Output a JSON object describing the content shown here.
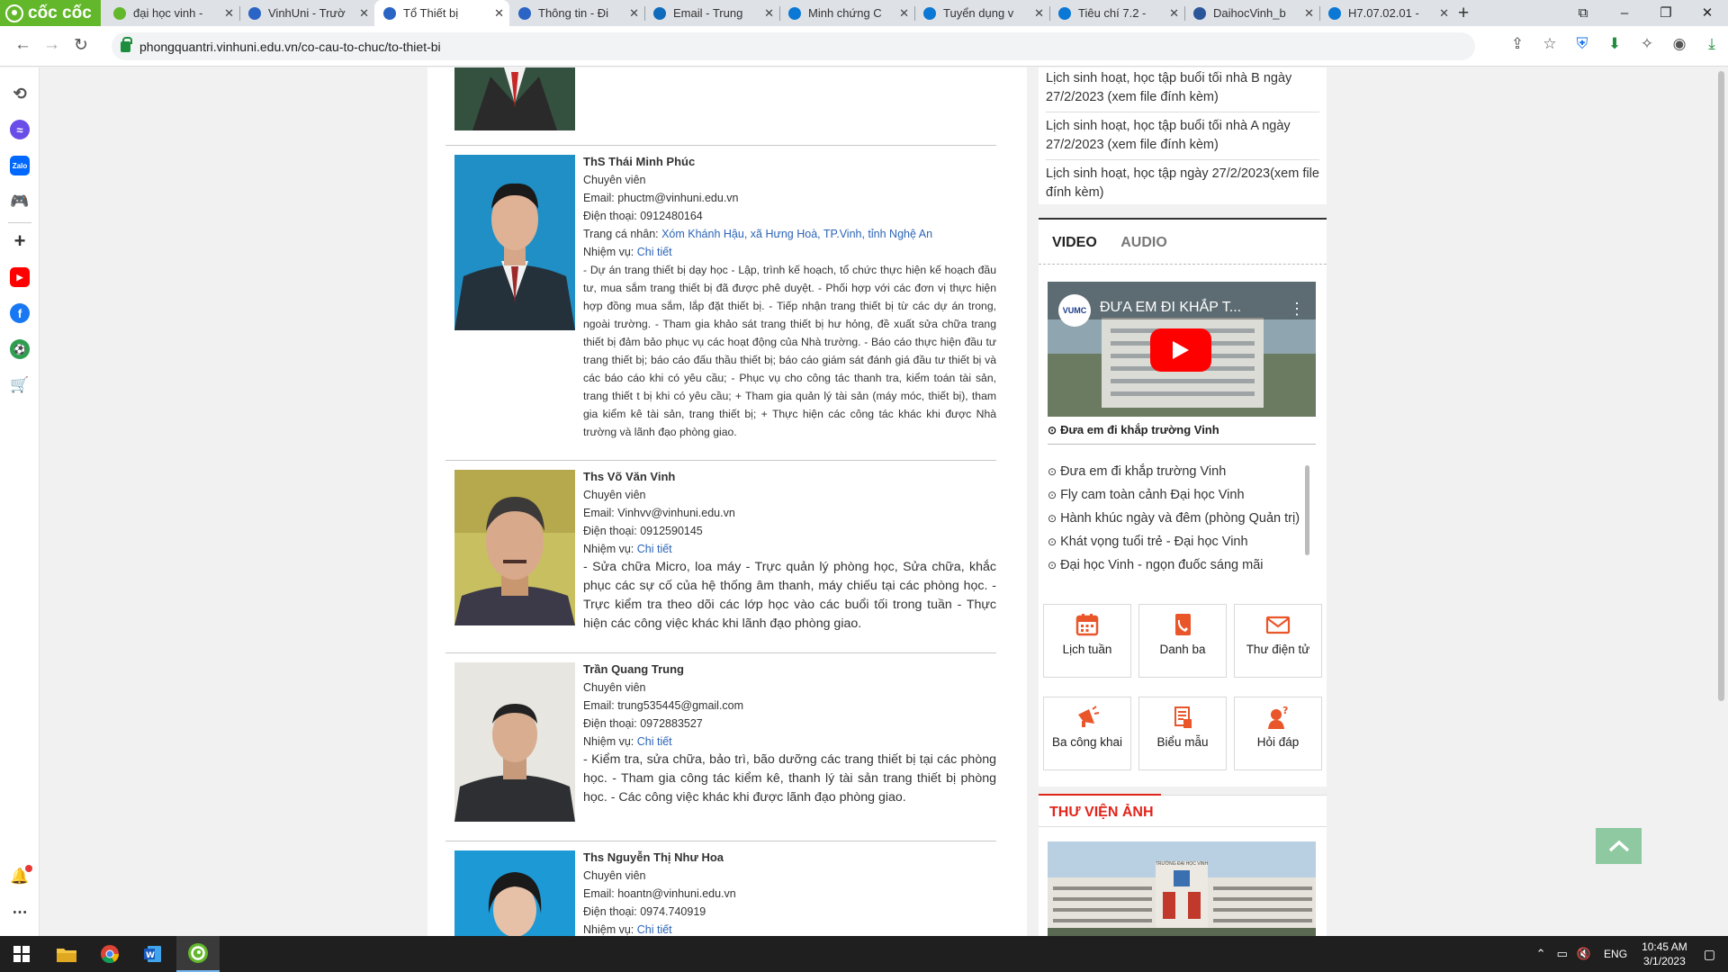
{
  "browser": {
    "brand": "cốc cốc",
    "tabs": [
      {
        "title": "đại học vinh -",
        "color": "#63b72b",
        "active": false
      },
      {
        "title": "VinhUni - Trườ",
        "color": "#2a64c5",
        "active": false
      },
      {
        "title": "Tổ Thiết bị",
        "color": "#2a64c5",
        "active": true
      },
      {
        "title": "Thông tin - Đi",
        "color": "#2a64c5",
        "active": false
      },
      {
        "title": "Email - Trung",
        "color": "#0f6cbd",
        "active": false
      },
      {
        "title": "Minh chứng C",
        "color": "#0a78d4",
        "active": false
      },
      {
        "title": "Tuyển dụng v",
        "color": "#0a78d4",
        "active": false
      },
      {
        "title": "Tiêu chí 7.2 -",
        "color": "#0a78d4",
        "active": false
      },
      {
        "title": "DaihocVinh_b",
        "color": "#2b579a",
        "active": false
      },
      {
        "title": "H7.07.02.01 -",
        "color": "#0a78d4",
        "active": false
      }
    ],
    "url": "phongquantri.vinhuni.edu.vn/co-cau-to-chuc/to-thiet-bi"
  },
  "staff": [
    {
      "name": "ThS Thái Minh Phúc",
      "role": "Chuyên viên",
      "email": "Email: phuctm@vinhuni.edu.vn",
      "phone": "Điện thoại: 0912480164",
      "homepage_label": "Trang cá nhân: ",
      "homepage_value": "Xóm Khánh Hậu, xã Hưng Hoà, TP.Vinh, tỉnh Nghệ An",
      "duty_label": "Nhiệm vụ: ",
      "duty_link": "Chi tiết",
      "duties": "- Dự án trang thiết bị dạy học - Lập, trình kế hoạch, tổ chức thực hiện kế hoạch đầu tư, mua sắm trang thiết bị đã được phê duyệt. - Phối hợp với các đơn vị thực hiện hợp đồng mua sắm, lắp đặt thiết bị. - Tiếp nhận trang thiết bị từ các dự án trong, ngoài trường. - Tham gia khảo sát trang thiết bị hư hỏng, đề xuất sửa chữa trang thiết bị đảm bảo phục vụ các hoạt động của Nhà trường. - Báo cáo thực hiện đầu tư trang thiết bị; báo cáo đấu thầu thiết bị; báo cáo giám sát đánh giá đầu tư thiết bị và các báo cáo khi có yêu cầu; - Phục vụ cho công tác thanh tra, kiểm toán tài sản, trang thiết t bị khi có yêu cầu; + Tham gia quản lý tài sản (máy móc, thiết bị), tham gia kiểm kê tài sản, trang thiết bị; + Thực hiện các công tác khác khi được Nhà trường và lãnh đạo phòng giao."
    },
    {
      "name": "Ths Võ Văn Vinh",
      "role": "Chuyên viên",
      "email": "Email: Vinhvv@vinhuni.edu.vn",
      "phone": "Điện thoại: 0912590145",
      "duty_label": "Nhiệm vụ: ",
      "duty_link": "Chi tiết",
      "duties": "- Sửa chữa Micro, loa máy - Trực quản lý phòng học, Sửa chữa, khắc phục các sự cố của hệ thống âm thanh, máy chiếu tại các phòng học. - Trực kiểm tra theo dõi các lớp học vào các buổi tối trong tuần - Thực hiện các công việc khác khi lãnh đạo phòng giao."
    },
    {
      "name": "Trần Quang Trung",
      "role": "Chuyên viên",
      "email": "Email: trung535445@gmail.com",
      "phone": "Điện thoại: 0972883527",
      "duty_label": "Nhiệm vụ: ",
      "duty_link": "Chi tiết",
      "duties": "- Kiểm tra, sửa chữa, bảo trì, bão dưỡng các trang thiết bị tại các phòng học. - Tham gia công tác kiểm kê, thanh lý tài sản trang thiết bị phòng học. - Các công việc khác khi được lãnh đạo phòng giao."
    },
    {
      "name": "Ths Nguyễn Thị Như Hoa",
      "role": "Chuyên viên",
      "email": "Email: hoantn@vinhuni.edu.vn",
      "phone": "Điện thoại: 0974.740919",
      "duty_label": "Nhiệm vụ: ",
      "duty_link": "Chi tiết"
    }
  ],
  "sidebar": {
    "news": [
      "Lịch sinh hoạt, học tập buổi tối nhà B ngày 27/2/2023 (xem file đính kèm)",
      "Lịch sinh hoạt, học tập buổi tối nhà A ngày 27/2/2023 (xem file đính kèm)",
      "Lịch sinh hoạt, học tập ngày 27/2/2023(xem file đính kèm)"
    ],
    "media_tabs": [
      "VIDEO",
      "AUDIO"
    ],
    "video": {
      "channel": "VUMC",
      "title": "ĐƯA EM ĐI KHẮP T...",
      "caption": "Đưa em đi khắp trường Vinh"
    },
    "playlist": [
      "Đưa em đi khắp trường Vinh",
      "Fly cam toàn cảnh Đại học Vinh",
      "Hành khúc ngày và đêm (phòng Quản trị)",
      "Khát vọng tuổi trẻ - Đại học Vinh",
      "Đại học Vinh - ngọn đuốc sáng mãi"
    ],
    "quick_links": [
      "Lịch tuần",
      "Danh ba",
      "Thư điện tử",
      "Ba công khai",
      "Biểu mẫu",
      "Hỏi đáp"
    ],
    "gallery_title": "THƯ VIỆN ẢNH",
    "gallery_sign": "TRƯỜNG ĐẠI HỌC VINH",
    "accent_color": "#e1251b"
  },
  "taskbar": {
    "language": "ENG",
    "time": "10:45 AM",
    "date": "3/1/2023"
  }
}
